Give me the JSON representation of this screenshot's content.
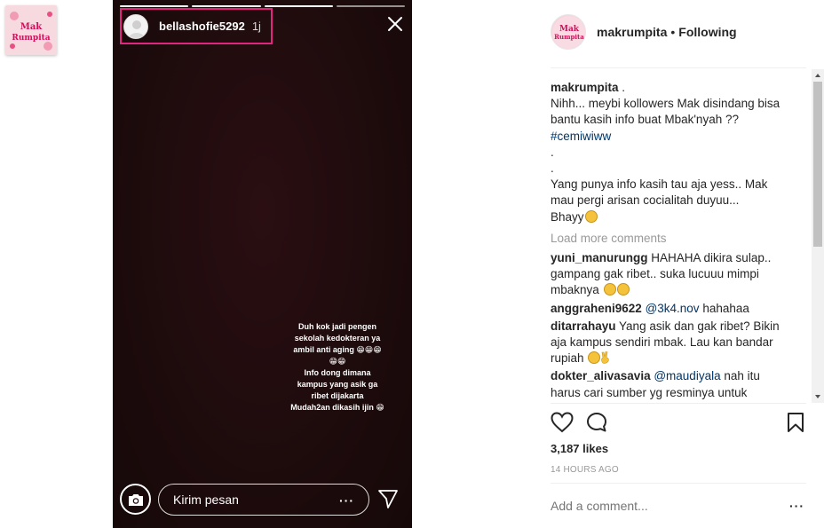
{
  "thumbnail": {
    "brand_line1": "Mak",
    "brand_line2": "Rumpita"
  },
  "story": {
    "username": "bellashofie5292",
    "time": "1j",
    "caption_lines": [
      "Duh kok jadi pengen",
      "sekolah kedokteran ya",
      "ambil anti aging 😁😁😁",
      "😁😁",
      "Info dong dimana",
      "kampus yang asik ga",
      "ribet dijakarta",
      "Mudah2an dikasih ijin 😁"
    ],
    "message_placeholder": "Kirim pesan",
    "message_more": "···"
  },
  "post": {
    "owner": "makrumpita",
    "separator": "•",
    "follow_status": "Following",
    "caption": {
      "username": "makrumpita",
      "first": ".",
      "lines": [
        "Nihh... meybi kollowers Mak disindang bisa",
        "bantu kasih info buat Mbak'nyah ??"
      ],
      "hashtag": "#cemiwiww",
      "dots": [
        ".",
        "."
      ],
      "lines2": [
        "Yang punya info kasih tau aja yess.. Mak",
        "mau pergi arisan cocialitah duyuu...",
        "Bhayy"
      ]
    },
    "load_more": "Load more comments",
    "comments": [
      {
        "username": "yuni_manurungg",
        "text": "HAHAHA dikira sulap..",
        "more": [
          "gampang gak ribet.. suka lucuuu mimpi",
          "mbaknya"
        ]
      },
      {
        "username": "anggraheni9622",
        "mention": "@3k4.nov",
        "text": "hahahaa"
      },
      {
        "username": "ditarrahayu",
        "text": "Yang asik dan gak ribet? Bikin",
        "more": [
          "aja kampus sendiri mbak. Lau kan bandar",
          "rupiah"
        ]
      },
      {
        "username": "dokter_alivasavia",
        "mention": "@maudiyala",
        "text": "nah itu",
        "more": [
          "harus cari sumber yg resminya untuk"
        ]
      }
    ],
    "likes": "3,187 likes",
    "time_ago": "14 HOURS AGO",
    "add_comment_placeholder": "Add a comment...",
    "more_options": "···"
  }
}
